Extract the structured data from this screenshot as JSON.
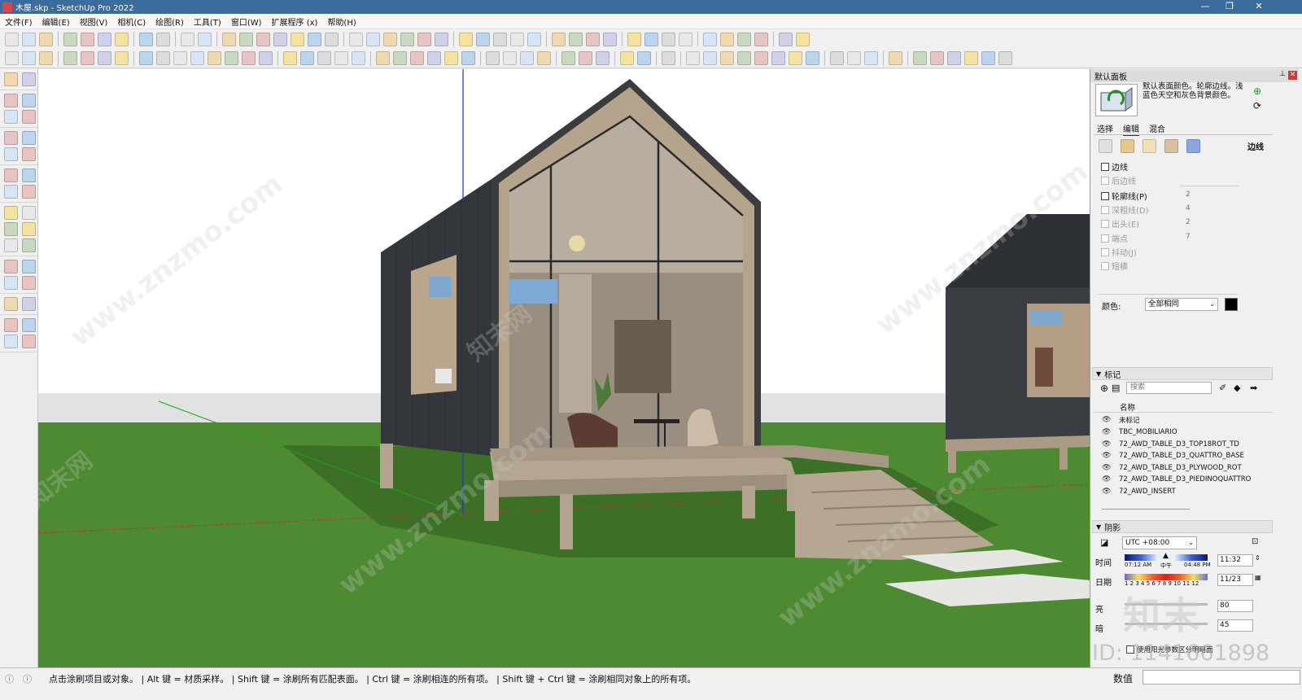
{
  "window": {
    "title": "木屋.skp - SketchUp Pro 2022",
    "minimize": "—",
    "maximize": "❐",
    "close": "✕"
  },
  "menu": [
    "文件(F)",
    "编辑(E)",
    "视图(V)",
    "相机(C)",
    "绘图(R)",
    "工具(T)",
    "窗口(W)",
    "扩展程序 (x)",
    "帮助(H)"
  ],
  "panel": {
    "title": "默认面板",
    "style_description": "默认表面颜色。轮廓边线。浅蓝色天空和灰色背景颜色。",
    "style_tabs": [
      "选择",
      "编辑",
      "混合"
    ],
    "active_style_tab": "编辑",
    "edge_label": "边线",
    "edge_options": [
      {
        "label": "边线",
        "enabled": true,
        "value": ""
      },
      {
        "label": "后边线",
        "enabled": false,
        "value": ""
      },
      {
        "label": "轮廓线(P)",
        "enabled": true,
        "value": "2"
      },
      {
        "label": "深粗线(D)",
        "enabled": false,
        "value": "4"
      },
      {
        "label": "出头(E)",
        "enabled": false,
        "value": "2"
      },
      {
        "label": "端点",
        "enabled": false,
        "value": "7"
      },
      {
        "label": "抖动(J)",
        "enabled": false,
        "value": ""
      },
      {
        "label": "短横",
        "enabled": false,
        "value": ""
      }
    ],
    "color_label": "颜色:",
    "color_value": "全部相同",
    "color_swatch": "#000000",
    "tags_section": "标记",
    "search_placeholder": "搜索",
    "tags_name_header": "名称",
    "tags": [
      "未标记",
      "TBC_MOBILIARIO",
      "72_AWD_TABLE_D3_TOP18ROT_TD",
      "72_AWD_TABLE_D3_QUATTRO_BASE",
      "72_AWD_TABLE_D3_PLYWOOD_ROT",
      "72_AWD_TABLE_D3_PIEDINOQUATTRO",
      "72_AWD_INSERT"
    ],
    "shadows_section": "阴影",
    "timezone": "UTC +08:00",
    "time_label": "时间",
    "time_start": "07:12 AM",
    "time_mid": "中午",
    "time_end": "04:48 PM",
    "time_value": "11:32",
    "date_label": "日期",
    "months": "1 2 3 4 5 6 7 8 9 10 11 12",
    "date_value": "11/23",
    "light_label": "亮",
    "light_value": "80",
    "dark_label": "暗",
    "dark_value": "45",
    "sun_option": "使用阳光参数区分明暗面"
  },
  "status": {
    "hint": "点击涂刷项目或对象。 | Alt 键 = 材质采样。 | Shift 键 = 涂刷所有匹配表面。 | Ctrl 键 = 涂刷相连的所有项。 | Shift 键 + Ctrl 键 = 涂刷相同对象上的所有项。",
    "measurements_label": "数值"
  },
  "watermark": {
    "site": "www.znzmo.com",
    "brand": "知末网",
    "logo": "知末",
    "id": "ID: 1141661898"
  },
  "colors": {
    "titlebar": "#3c6c9c",
    "sky": "#ffffff",
    "ground": "#4d8a32",
    "cabin_dark": "#33373c",
    "wood": "#a89a86",
    "accent": "#2e6bbf"
  }
}
